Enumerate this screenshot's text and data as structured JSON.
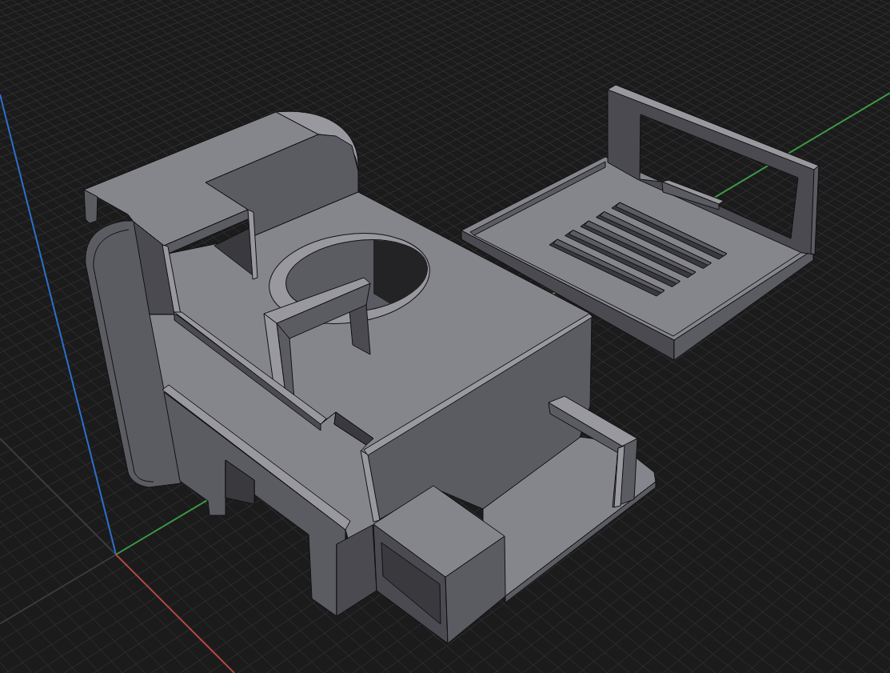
{
  "viewport": {
    "axes": [
      {
        "color": "#2e6fcb"
      },
      {
        "color": "#3e9b42"
      },
      {
        "color": "#b5473f"
      }
    ]
  }
}
